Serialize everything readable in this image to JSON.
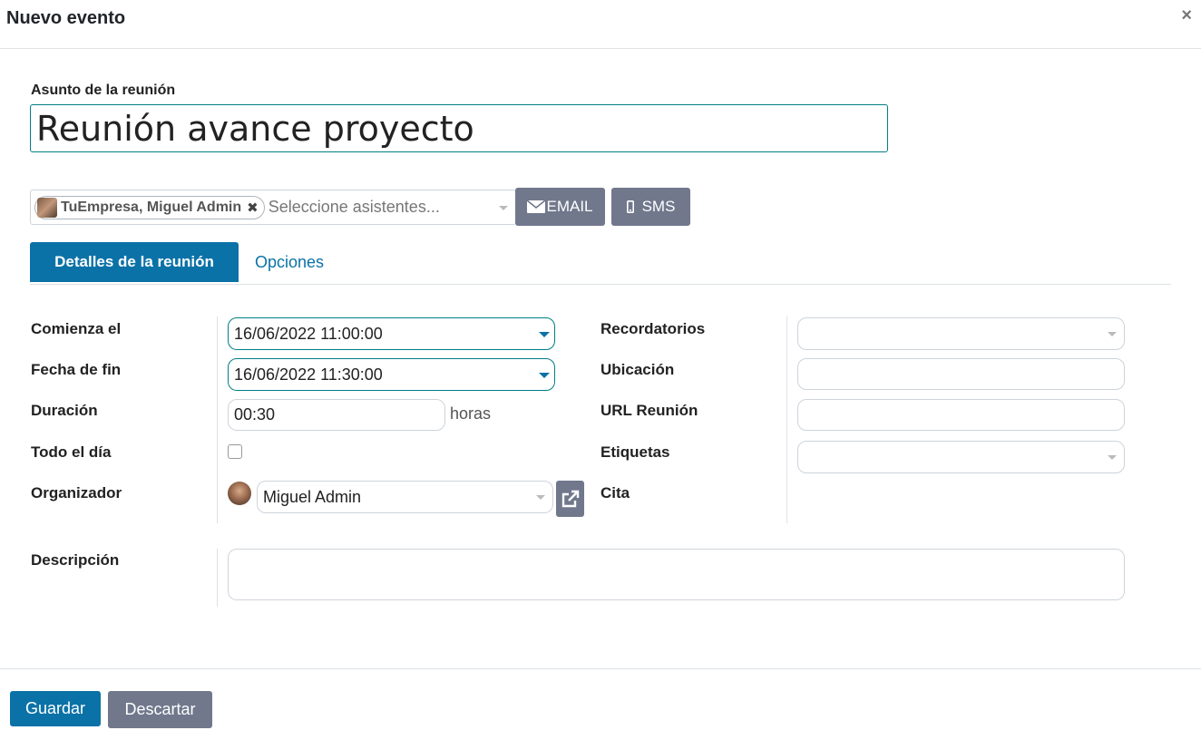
{
  "dialog": {
    "title": "Nuevo evento",
    "close_symbol": "×"
  },
  "subject": {
    "label": "Asunto de la reunión",
    "value": "Reunión avance proyecto"
  },
  "attendees": {
    "tags": [
      {
        "label": "TuEmpresa, Miguel Admin",
        "remove_symbol": "✖"
      }
    ],
    "placeholder": "Seleccione asistentes..."
  },
  "actions": {
    "email_label": "EMAIL",
    "sms_label": "SMS"
  },
  "tabs": [
    {
      "label": "Detalles de la reunión",
      "active": true
    },
    {
      "label": "Opciones",
      "active": false
    }
  ],
  "left_fields": {
    "start": {
      "label": "Comienza el",
      "value": "16/06/2022 11:00:00"
    },
    "end": {
      "label": "Fecha de fin",
      "value": "16/06/2022 11:30:00"
    },
    "duration": {
      "label": "Duración",
      "value": "00:30",
      "unit": "horas"
    },
    "all_day": {
      "label": "Todo el día",
      "checked": false
    },
    "organizer": {
      "label": "Organizador",
      "value": "Miguel Admin"
    }
  },
  "right_fields": {
    "reminders": {
      "label": "Recordatorios",
      "value": ""
    },
    "location": {
      "label": "Ubicación",
      "value": ""
    },
    "meeting_url": {
      "label": "URL Reunión",
      "value": ""
    },
    "tags": {
      "label": "Etiquetas",
      "value": ""
    },
    "appointment": {
      "label": "Cita"
    }
  },
  "description": {
    "label": "Descripción",
    "value": ""
  },
  "footer": {
    "save_label": "Guardar",
    "discard_label": "Descartar"
  },
  "colors": {
    "primary": "#0b72a7",
    "secondary": "#71788c",
    "focus_border": "#017e84"
  }
}
